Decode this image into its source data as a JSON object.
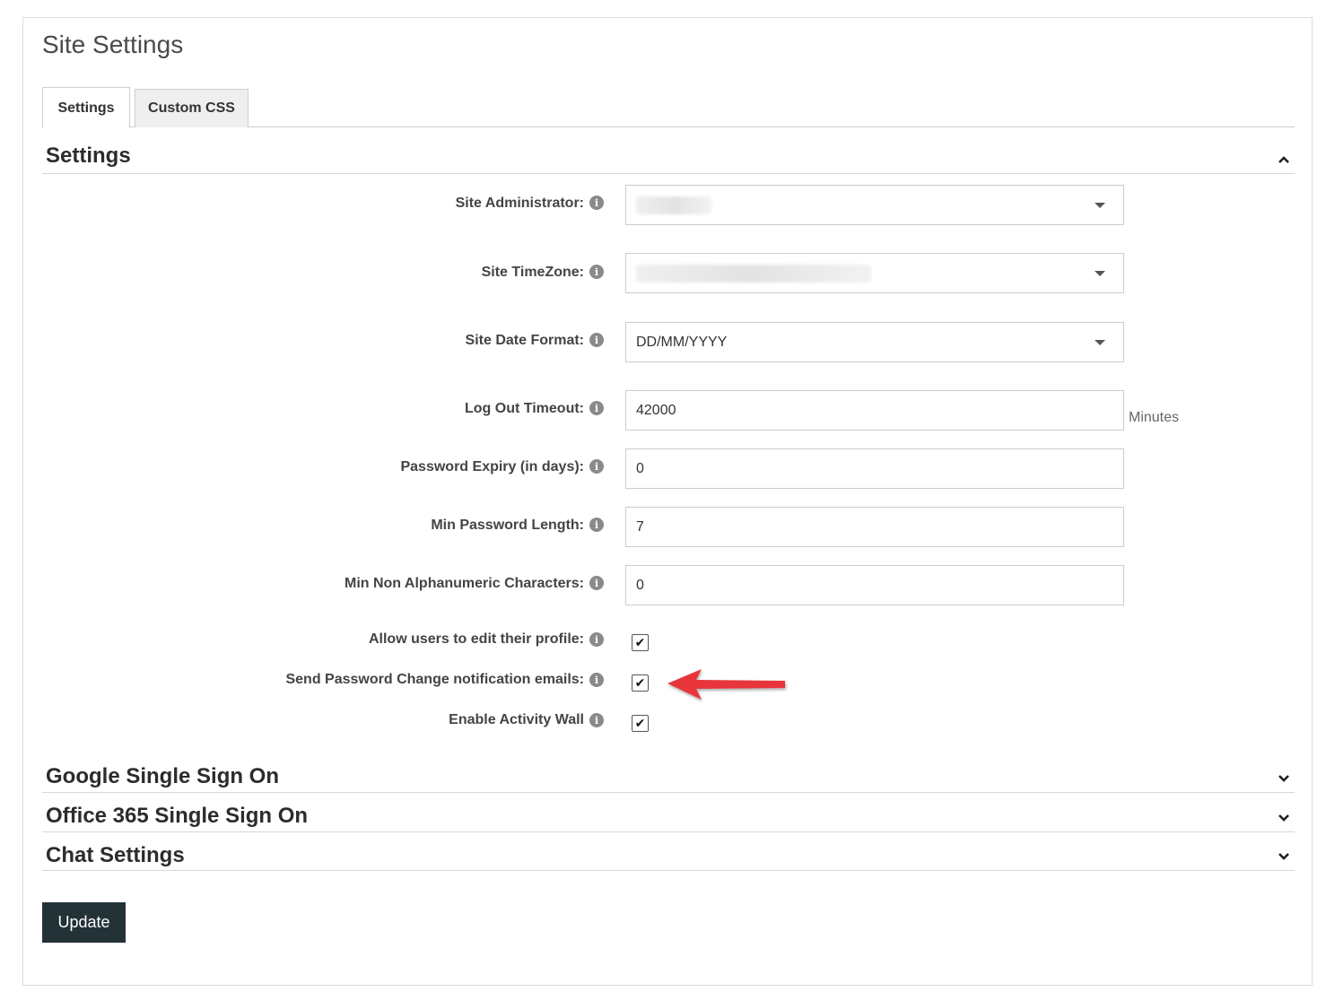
{
  "page": {
    "title": "Site Settings"
  },
  "tabs": [
    {
      "label": "Settings",
      "active": true
    },
    {
      "label": "Custom CSS",
      "active": false
    }
  ],
  "sections": {
    "settings": {
      "title": "Settings",
      "expanded": true
    },
    "google_sso": {
      "title": "Google Single Sign On",
      "expanded": false
    },
    "office365_sso": {
      "title": "Office 365 Single Sign On",
      "expanded": false
    },
    "chat": {
      "title": "Chat Settings",
      "expanded": false
    }
  },
  "fields": {
    "site_administrator": {
      "label": "Site Administrator:",
      "value": ""
    },
    "site_timezone": {
      "label": "Site TimeZone:",
      "value": ""
    },
    "site_date_format": {
      "label": "Site Date Format:",
      "value": "DD/MM/YYYY"
    },
    "logout_timeout": {
      "label": "Log Out Timeout:",
      "value": "42000",
      "unit": "Minutes"
    },
    "password_expiry": {
      "label": "Password Expiry (in days):",
      "value": "0"
    },
    "min_password_length": {
      "label": "Min Password Length:",
      "value": "7"
    },
    "min_non_alnum": {
      "label": "Min Non Alphanumeric Characters:",
      "value": "0"
    },
    "allow_edit_profile": {
      "label": "Allow users to edit their profile:",
      "checked": true
    },
    "send_pw_change_email": {
      "label": "Send Password Change notification emails:",
      "checked": true
    },
    "enable_activity_wall": {
      "label": "Enable Activity Wall",
      "checked": true
    }
  },
  "icons": {
    "info": "info-icon",
    "expand": "chevron-down-icon",
    "collapse": "chevron-up-icon",
    "dropdown": "caret-down-icon",
    "check": "✔"
  },
  "annotation": {
    "arrow_color": "#e8363a"
  },
  "actions": {
    "update_label": "Update"
  },
  "colors": {
    "button_bg": "#233237"
  }
}
